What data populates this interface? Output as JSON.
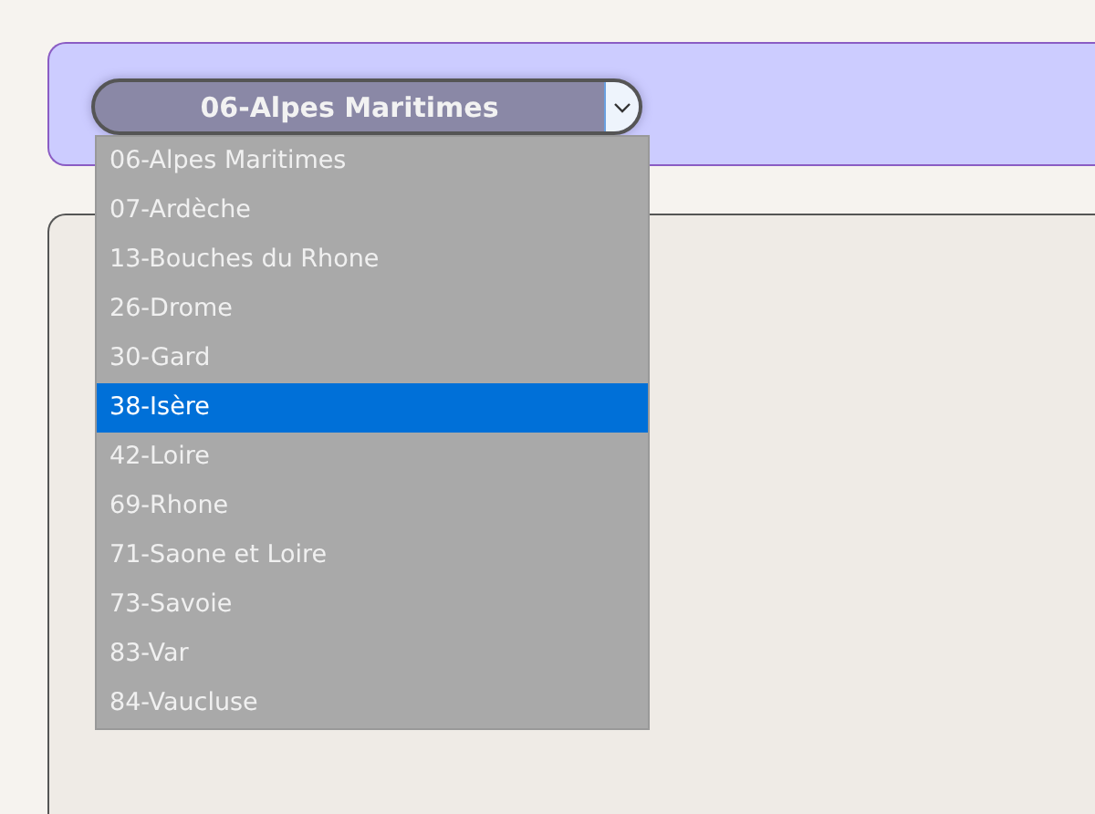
{
  "select": {
    "value": "06-Alpes Maritimes"
  },
  "options": [
    {
      "label": "06-Alpes Maritimes",
      "selected": false
    },
    {
      "label": "07-Ardèche",
      "selected": false
    },
    {
      "label": "13-Bouches du Rhone",
      "selected": false
    },
    {
      "label": "26-Drome",
      "selected": false
    },
    {
      "label": "30-Gard",
      "selected": false
    },
    {
      "label": "38-Isère",
      "selected": true
    },
    {
      "label": "42-Loire",
      "selected": false
    },
    {
      "label": "69-Rhone",
      "selected": false
    },
    {
      "label": "71-Saone et Loire",
      "selected": false
    },
    {
      "label": "73-Savoie",
      "selected": false
    },
    {
      "label": "83-Var",
      "selected": false
    },
    {
      "label": "84-Vaucluse",
      "selected": false
    }
  ]
}
